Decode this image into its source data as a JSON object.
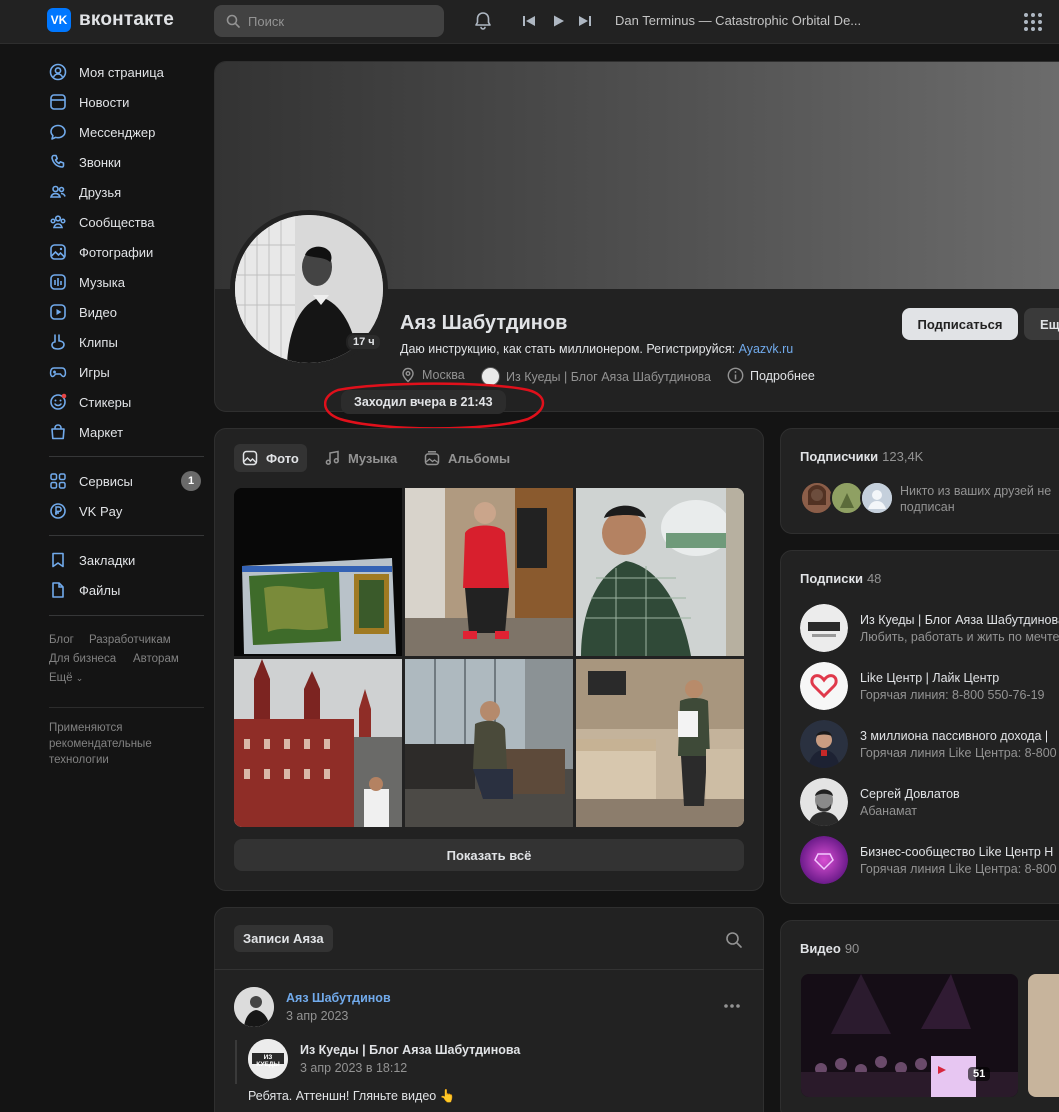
{
  "header": {
    "logo_mark": "VK",
    "logo_text": "вконтакте",
    "search_placeholder": "Поиск",
    "track": "Dan Terminus — Catastrophic Orbital De..."
  },
  "sidebar": {
    "items": [
      {
        "label": "Моя страница",
        "icon": "user-circle-icon"
      },
      {
        "label": "Новости",
        "icon": "newspaper-icon"
      },
      {
        "label": "Мессенджер",
        "icon": "message-bubble-icon"
      },
      {
        "label": "Звонки",
        "icon": "phone-icon"
      },
      {
        "label": "Друзья",
        "icon": "friends-icon"
      },
      {
        "label": "Сообщества",
        "icon": "communities-icon"
      },
      {
        "label": "Фотографии",
        "icon": "photo-icon"
      },
      {
        "label": "Музыка",
        "icon": "music-icon"
      },
      {
        "label": "Видео",
        "icon": "video-icon"
      },
      {
        "label": "Клипы",
        "icon": "clips-icon"
      },
      {
        "label": "Игры",
        "icon": "gamepad-icon"
      },
      {
        "label": "Стикеры",
        "icon": "sticker-icon"
      },
      {
        "label": "Маркет",
        "icon": "shopping-bag-icon"
      }
    ],
    "services": [
      {
        "label": "Сервисы",
        "icon": "services-grid-icon",
        "badge": "1"
      },
      {
        "label": "VK Pay",
        "icon": "vkpay-icon"
      }
    ],
    "saved": [
      {
        "label": "Закладки",
        "icon": "bookmark-icon"
      },
      {
        "label": "Файлы",
        "icon": "file-icon"
      }
    ],
    "footer_links": [
      "Блог",
      "Разработчикам",
      "Для бизнеса",
      "Авторам",
      "Ещё"
    ],
    "note": [
      "Применяются",
      "рекомендательные",
      "технологии"
    ]
  },
  "profile": {
    "name": "Аяз Шабутдинов",
    "status_text": "Даю инструкцию, как стать миллионером. Регистрируйся: ",
    "status_link": "Ayazvk.ru",
    "city": "Москва",
    "community": "Из Куеды | Блог Аяза Шабутдинова",
    "details": "Подробнее",
    "online_badge": "17 ч",
    "last_seen": "Заходил вчера в 21:43",
    "subscribe": "Подписаться",
    "more": "Ещё"
  },
  "media": {
    "tabs": [
      "Фото",
      "Музыка",
      "Альбомы"
    ],
    "show_all": "Показать всё"
  },
  "subscribers": {
    "title": "Подписчики",
    "count": "123,4K",
    "note_1": "Никто из ваших друзей не",
    "note_2": "подписан"
  },
  "subscriptions": {
    "title": "Подписки",
    "count": "48",
    "items": [
      {
        "name": "Из Куеды | Блог Аяза Шабутдинова",
        "desc": "Любить, работать и жить по мечте"
      },
      {
        "name": "Like Центр | Лайк Центр",
        "desc": "Горячая линия: 8-800 550-76-19"
      },
      {
        "name": "3 миллиона пассивного дохода |",
        "desc": "Горячая линия Like Центра: 8-800"
      },
      {
        "name": "Сергей Довлатов",
        "desc": "Абанамат"
      },
      {
        "name": "Бизнес-сообщество Like Центр Н",
        "desc": "Горячая линия Like Центра: 8-800"
      }
    ]
  },
  "videos": {
    "title": "Видео",
    "count": "90",
    "first_count": "51"
  },
  "posts": {
    "tab": "Записи Аяза",
    "author": "Аяз Шабутдинов",
    "date": "3 апр 2023",
    "repost_author": "Из Куеды | Блог Аяза Шабутдинова",
    "repost_date": "3 апр 2023 в 18:12",
    "text": "Ребята. Аттеншн! Гляньте видео 👆",
    "repost_logo": "ИЗ КУЕДЫ"
  }
}
